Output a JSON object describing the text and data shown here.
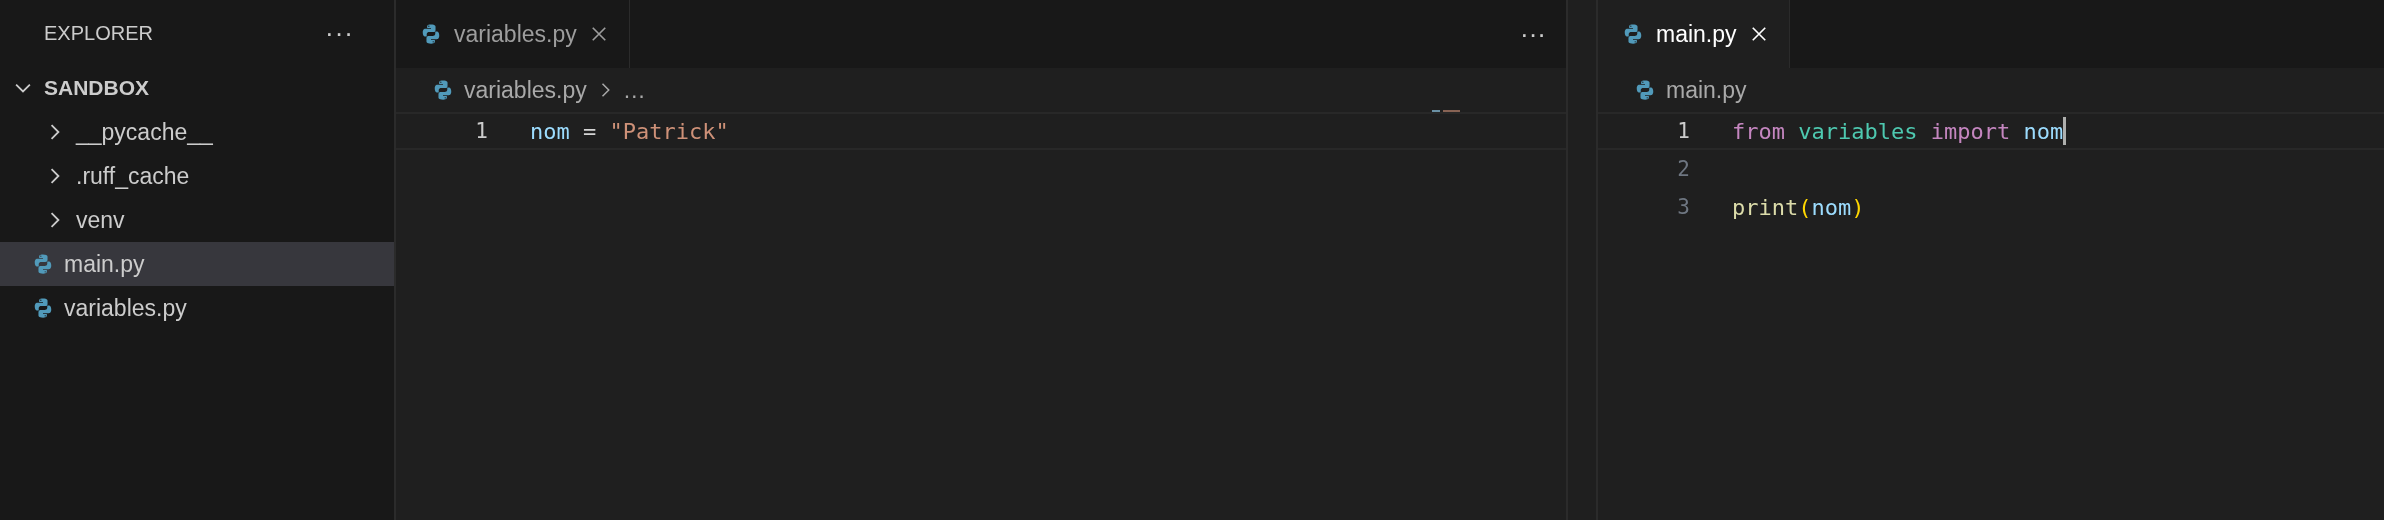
{
  "sidebar": {
    "title": "EXPLORER",
    "more": "···",
    "tree": {
      "label": "SANDBOX",
      "expanded": true,
      "children": [
        {
          "label": "__pycache__",
          "kind": "folder",
          "expanded": false,
          "selected": false
        },
        {
          "label": ".ruff_cache",
          "kind": "folder",
          "expanded": false,
          "selected": false
        },
        {
          "label": "venv",
          "kind": "folder",
          "expanded": false,
          "selected": false
        },
        {
          "label": "main.py",
          "kind": "python",
          "selected": true
        },
        {
          "label": "variables.py",
          "kind": "python",
          "selected": false
        }
      ]
    }
  },
  "editor_groups": [
    {
      "more": "···",
      "tabs": [
        {
          "label": "variables.py",
          "selected": false
        }
      ],
      "breadcrumbs": [
        "variables.py",
        "…"
      ],
      "minimap": true,
      "lines": [
        {
          "number": "1",
          "current": true,
          "cursor": false,
          "tokens": [
            {
              "text": "nom ",
              "kind": "variable"
            },
            {
              "text": "= ",
              "kind": "operator"
            },
            {
              "text": "\"Patrick\"",
              "kind": "string"
            }
          ]
        }
      ]
    },
    {
      "tabs": [
        {
          "label": "main.py",
          "selected": true
        }
      ],
      "breadcrumbs": [
        "main.py"
      ],
      "lines": [
        {
          "number": "1",
          "current": true,
          "cursor": true,
          "tokens": [
            {
              "text": "from ",
              "kind": "keyword"
            },
            {
              "text": "variables ",
              "kind": "module"
            },
            {
              "text": "import ",
              "kind": "keyword"
            },
            {
              "text": "nom",
              "kind": "variable"
            }
          ]
        },
        {
          "number": "2",
          "current": false,
          "cursor": false
        },
        {
          "number": "3",
          "current": false,
          "cursor": false,
          "tokens": [
            {
              "text": "print",
              "kind": "function"
            },
            {
              "text": "(",
              "kind": "paren"
            },
            {
              "text": "nom",
              "kind": "variable"
            },
            {
              "text": ")",
              "kind": "paren"
            }
          ]
        }
      ]
    }
  ]
}
